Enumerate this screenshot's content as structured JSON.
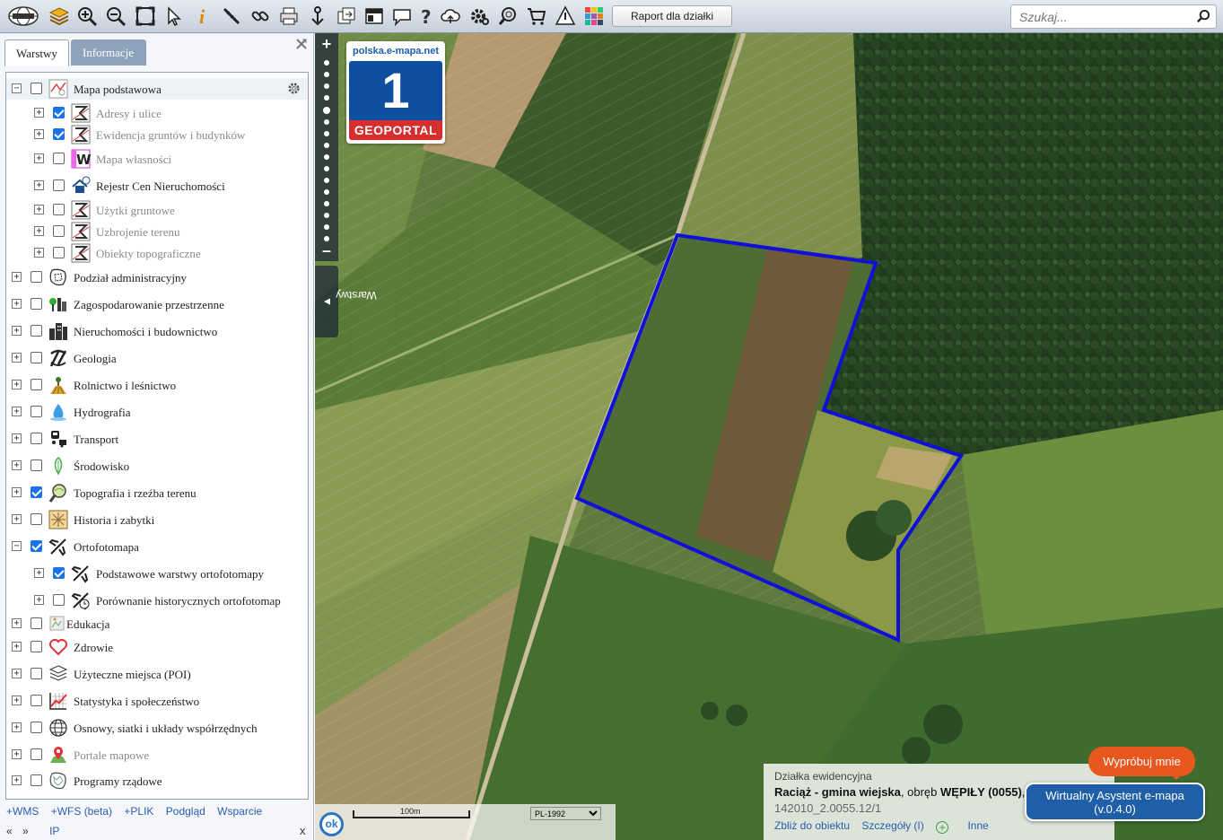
{
  "toolbar": {
    "raport_button": "Raport dla działki",
    "search_placeholder": "Szukaj...",
    "icons": [
      "logo-globe-icon",
      "layers-icon",
      "zoom-in-icon",
      "zoom-out-icon",
      "full-extent-icon",
      "pointer-icon",
      "info-icon",
      "measure-icon",
      "link-icon",
      "print-icon",
      "download-icon",
      "export-icon",
      "layout-icon",
      "comment-icon",
      "help-icon",
      "cloud-upload-icon",
      "settings-icon",
      "find-icon",
      "cart-icon",
      "warning-icon",
      "color-grid-icon"
    ]
  },
  "panel": {
    "tabs": [
      "Warstwy",
      "Informacje"
    ],
    "active_tab": "Warstwy",
    "layers": [
      {
        "label": "Mapa podstawowa",
        "level": 0,
        "checked": false,
        "expanded": true,
        "grey": false,
        "icon": "base-map-icon"
      },
      {
        "label": "Adresy i ulice",
        "level": 1,
        "checked": true,
        "grey": true,
        "icon": "wms-sigma-icon"
      },
      {
        "label": "Ewidencja gruntów i budynków",
        "level": 1,
        "checked": true,
        "grey": true,
        "icon": "wms-sigma-icon"
      },
      {
        "label": "Mapa własności",
        "level": 1,
        "checked": false,
        "grey": true,
        "icon": "ownership-w-icon"
      },
      {
        "label": "Rejestr Cen Nieruchomości",
        "level": 1,
        "checked": false,
        "grey": false,
        "icon": "house-price-icon"
      },
      {
        "label": "Użytki gruntowe",
        "level": 1,
        "checked": false,
        "grey": true,
        "icon": "wms-sigma-icon"
      },
      {
        "label": "Uzbrojenie terenu",
        "level": 1,
        "checked": false,
        "grey": true,
        "icon": "wms-sigma-icon"
      },
      {
        "label": "Obiekty topograficzne",
        "level": 1,
        "checked": false,
        "grey": true,
        "icon": "wms-sigma-icon"
      },
      {
        "label": "Podział administracyjny",
        "level": 0,
        "checked": false,
        "grey": false,
        "icon": "admin-map-icon"
      },
      {
        "label": "Zagospodarowanie przestrzenne",
        "level": 0,
        "checked": false,
        "grey": false,
        "icon": "spatial-planning-icon"
      },
      {
        "label": "Nieruchomości i budownictwo",
        "level": 0,
        "checked": false,
        "grey": false,
        "icon": "buildings-icon"
      },
      {
        "label": "Geologia",
        "level": 0,
        "checked": false,
        "grey": false,
        "icon": "pickaxe-icon"
      },
      {
        "label": "Rolnictwo i leśnictwo",
        "level": 0,
        "checked": false,
        "grey": false,
        "icon": "agriculture-icon"
      },
      {
        "label": "Hydrografia",
        "level": 0,
        "checked": false,
        "grey": false,
        "icon": "water-drop-icon"
      },
      {
        "label": "Transport",
        "level": 0,
        "checked": false,
        "grey": false,
        "icon": "transport-icon"
      },
      {
        "label": "Środowisko",
        "level": 0,
        "checked": false,
        "grey": false,
        "icon": "leaf-icon"
      },
      {
        "label": "Topografia i rzeźba terenu",
        "level": 0,
        "checked": true,
        "grey": false,
        "icon": "topography-icon"
      },
      {
        "label": "Historia i zabytki",
        "level": 0,
        "checked": false,
        "grey": false,
        "icon": "history-icon"
      },
      {
        "label": "Ortofotomapa",
        "level": 0,
        "checked": true,
        "expanded": true,
        "grey": false,
        "icon": "airplane-icon"
      },
      {
        "label": "Podstawowe warstwy ortofotomapy",
        "level": 1,
        "checked": true,
        "grey": false,
        "icon": "airplane-icon"
      },
      {
        "label": "Porównanie historycznych ortofotomap",
        "level": 1,
        "checked": false,
        "grey": false,
        "icon": "airplane-history-icon"
      },
      {
        "label": "Edukacja",
        "level": 0,
        "checked": false,
        "grey": false,
        "icon": "education-broken-icon"
      },
      {
        "label": "Zdrowie",
        "level": 0,
        "checked": false,
        "grey": false,
        "icon": "heart-icon"
      },
      {
        "label": "Użyteczne miejsca (POI)",
        "level": 0,
        "checked": false,
        "grey": false,
        "icon": "poi-layers-icon"
      },
      {
        "label": "Statystyka i społeczeństwo",
        "level": 0,
        "checked": false,
        "grey": false,
        "icon": "statistics-chart-icon"
      },
      {
        "label": "Osnowy, siatki i układy współrzędnych",
        "level": 0,
        "checked": false,
        "grey": false,
        "icon": "globe-grid-icon"
      },
      {
        "label": "Portale mapowe",
        "level": 0,
        "checked": false,
        "grey": true,
        "icon": "map-pin-icon"
      },
      {
        "label": "Programy rządowe",
        "level": 0,
        "checked": false,
        "grey": false,
        "icon": "government-programs-icon"
      }
    ],
    "bottom_links": [
      "+WMS",
      "+WFS (beta)",
      "+PLIK",
      "Podgląd",
      "Wsparcie"
    ],
    "nav_prev": "«",
    "nav_next": "»",
    "ip_link": "IP",
    "close_x": "x"
  },
  "map": {
    "vertical_tab": "Warstwy",
    "badge_site": "polska.e-mapa.net",
    "badge_number": "1",
    "badge_label": "GEOPORTAL",
    "ok_button": "ok",
    "scale_label": "100m",
    "crs_selected": "PL-1992",
    "parcel_outline_color": "#1010d8"
  },
  "info": {
    "title": "Działka ewidencyjna",
    "gmina": "Raciąż - gmina wiejska",
    "obreb_prefix": ", obręb ",
    "obreb": "WĘPIŁY (0055)",
    "trailing": ",",
    "parcel_id": "142010_2.0055.12/1",
    "link_zoom": "Zbliż do obiektu",
    "link_details": "Szczegóły (I)",
    "link_other": "Inne"
  },
  "assistant": {
    "try_label": "Wypróbuj mnie",
    "button_line1": "Wirtualny Asystent e-mapa",
    "button_line2": "(v.0.4.0)"
  }
}
